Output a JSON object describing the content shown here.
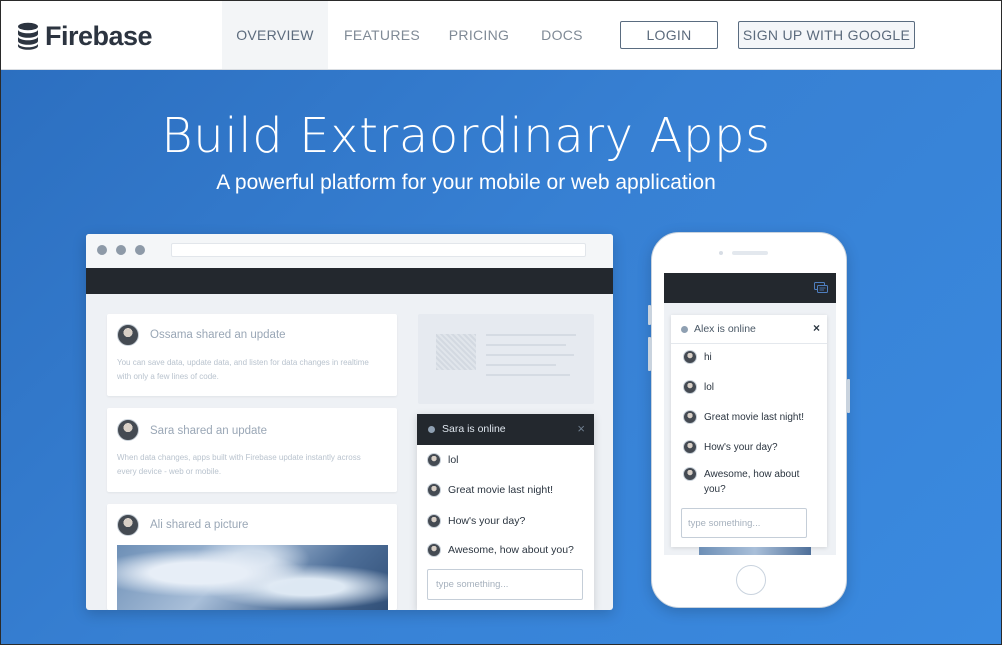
{
  "brand": {
    "name": "Firebase",
    "logo_icon": "database-stack-icon"
  },
  "nav": {
    "items": [
      {
        "label": "OVERVIEW",
        "active": true
      },
      {
        "label": "FEATURES",
        "active": false
      },
      {
        "label": "PRICING",
        "active": false
      },
      {
        "label": "DOCS",
        "active": false
      }
    ],
    "login_label": "LOGIN",
    "signup_label": "SIGN UP WITH GOOGLE"
  },
  "hero": {
    "title": "Build Extraordinary Apps",
    "subtitle": "A powerful platform for your mobile or web application"
  },
  "desktop_demo": {
    "feed": [
      {
        "title": "Ossama shared an update",
        "body": "You can save data, update data, and listen for data changes in realtime with only a few lines of code."
      },
      {
        "title": "Sara shared an update",
        "body": "When data changes, apps built with Firebase update instantly across every device - web or mobile."
      },
      {
        "title": "Ali shared a picture",
        "body": ""
      }
    ],
    "chat": {
      "header": "Sara is online",
      "close_glyph": "×",
      "messages": [
        "lol",
        "Great movie last night!",
        "How's your day?",
        "Awesome, how about you?"
      ],
      "input_placeholder": "type something..."
    }
  },
  "mobile_demo": {
    "chat": {
      "header": "Alex is online",
      "close_glyph": "×",
      "messages": [
        "hi",
        "lol",
        "Great movie last night!",
        "How's your day?",
        "Awesome, how about you?"
      ],
      "input_placeholder": "type something..."
    }
  },
  "colors": {
    "hero_blue": "#3780d3",
    "dark_bar": "#23282e",
    "nav_text": "#7f8a96",
    "brand_text": "#2c3440"
  }
}
